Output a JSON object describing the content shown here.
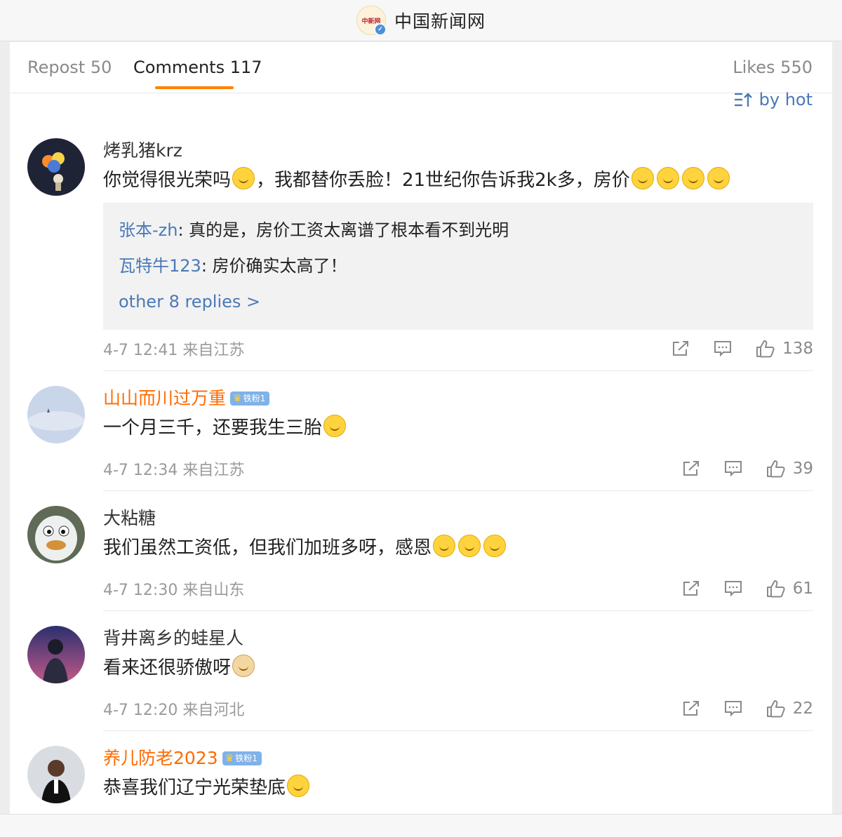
{
  "header": {
    "logo_text": "中新网",
    "site_title": "中国新闻网"
  },
  "tabs": {
    "repost": "Repost 50",
    "comments": "Comments 117",
    "likes": "Likes 550"
  },
  "sort": {
    "label": "by hot",
    "icon": "sort-icon"
  },
  "comments": [
    {
      "username": "烤乳猪krz",
      "text_parts": [
        "你觉得很光荣吗",
        "，我都替你丢脸！21世纪你告诉我2k多，房价"
      ],
      "replies": [
        {
          "who": "张本-zh",
          "text": ": 真的是，房价工资太离谱了根本看不到光明"
        },
        {
          "who": "瓦特牛123",
          "text": ": 房价确实太高了！"
        }
      ],
      "more_replies": "other 8 replies >",
      "time": "4-7 12:41 来自江苏",
      "likes": "138"
    },
    {
      "username": "山山而川过万重",
      "badge": "铁粉1",
      "text": "一个月三千，还要我生三胎",
      "time": "4-7 12:34 来自江苏",
      "likes": "39"
    },
    {
      "username": "大粘糖",
      "text": "我们虽然工资低，但我们加班多呀，感恩",
      "time": "4-7 12:30 来自山东",
      "likes": "61"
    },
    {
      "username": "背井离乡的蛙星人",
      "text": "看来还很骄傲呀",
      "time": "4-7 12:20 来自河北",
      "likes": "22"
    },
    {
      "username": "养儿防老2023",
      "badge": "铁粉1",
      "text": "恭喜我们辽宁光荣垫底"
    }
  ],
  "colors": {
    "accent": "#ff8200",
    "link": "#4a79b7",
    "vip_name": "#ff6a00"
  }
}
